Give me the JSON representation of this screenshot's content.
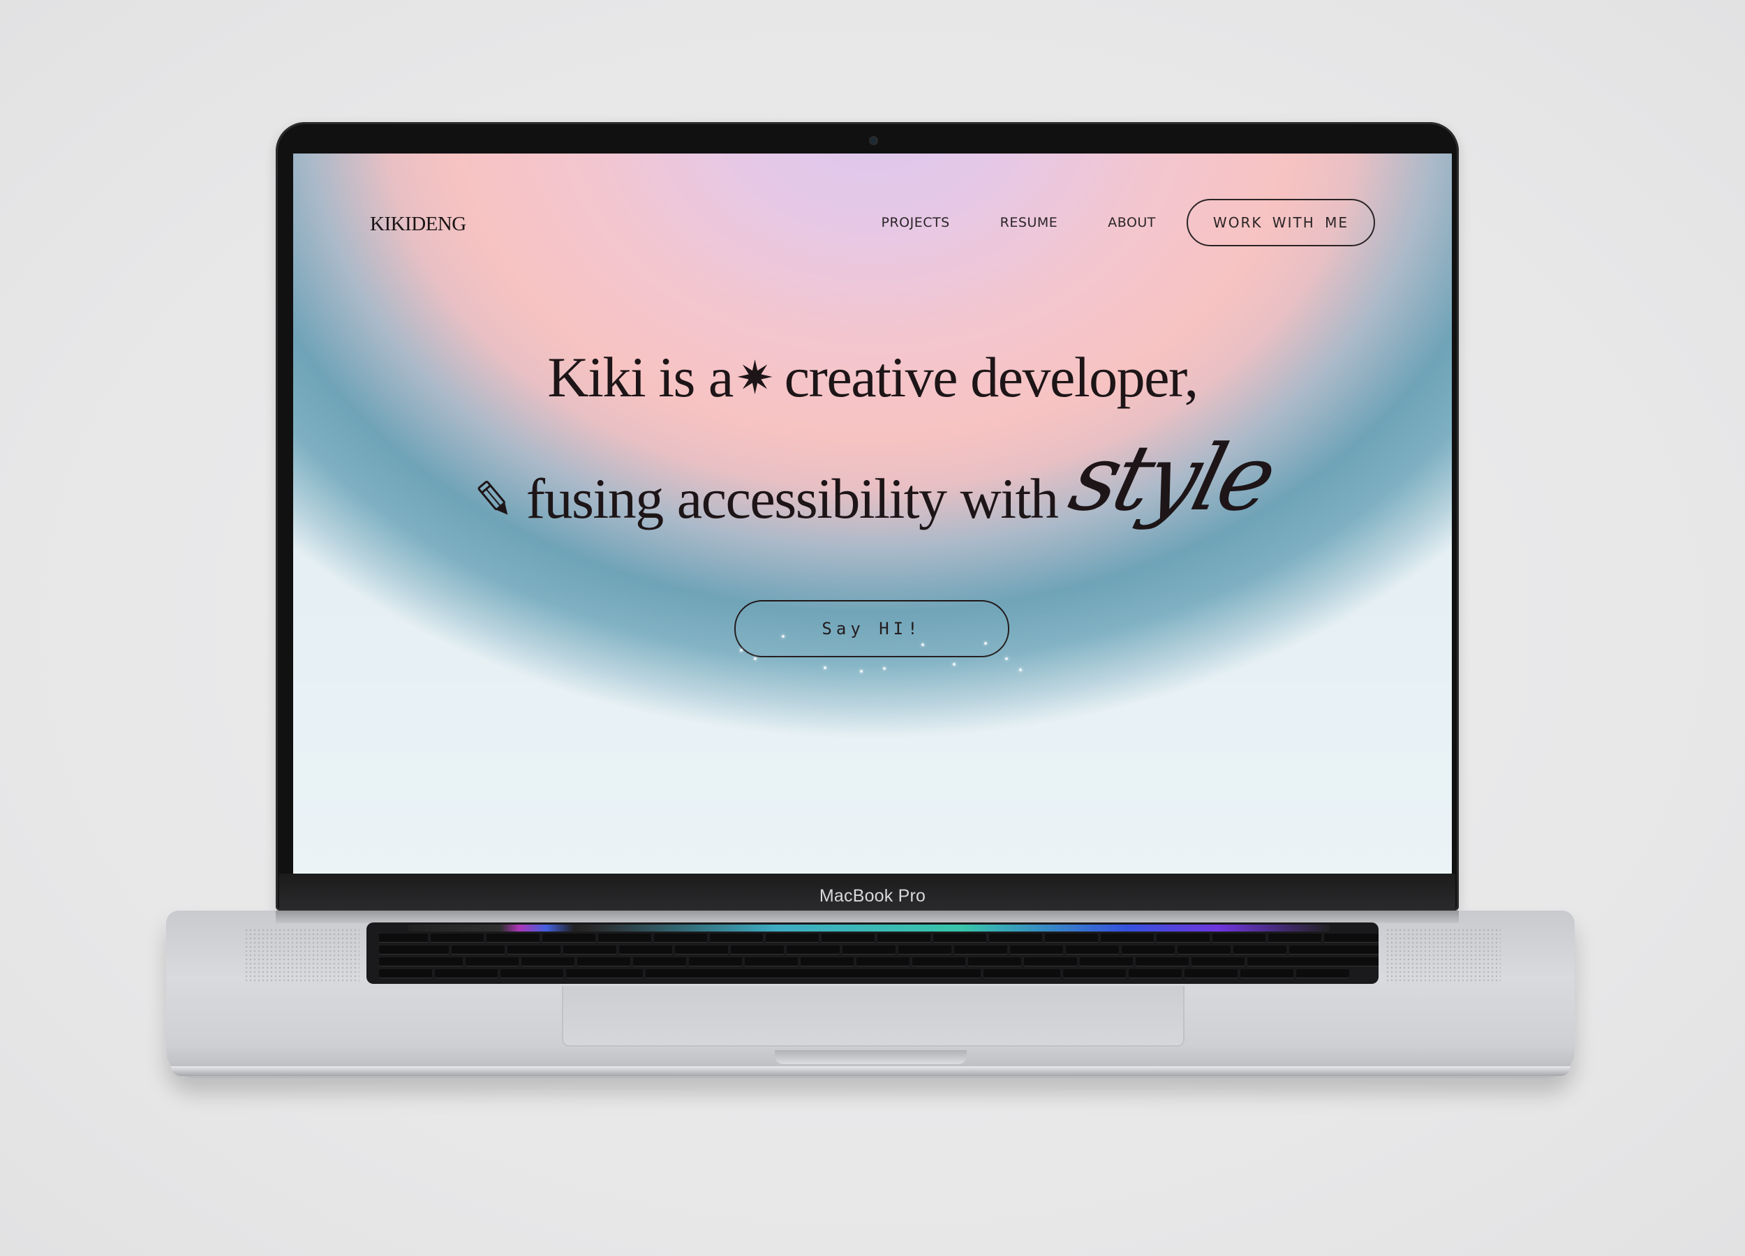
{
  "device": {
    "label": "MacBook Pro"
  },
  "site": {
    "logo": "KIKIDENG",
    "nav": {
      "links": [
        "PROJECTS",
        "RESUME",
        "ABOUT"
      ],
      "cta": "WORK WITH ME"
    },
    "hero": {
      "line1": {
        "part1": "Kiki is",
        "part2": "a",
        "part3": "creative developer,"
      },
      "line2": {
        "part1": "fusing",
        "part2": "accessibility",
        "part3": "with",
        "accent": "style"
      },
      "spark_icon": "eight-point-star-icon",
      "pencil_icon": "pencil-icon",
      "cta": "Say HI!"
    },
    "colors": {
      "text": "#1d1517",
      "gradient_top": "#dcc9ef",
      "gradient_pink": "#f7c3c2",
      "gradient_teal": "#6fa3b7"
    }
  }
}
